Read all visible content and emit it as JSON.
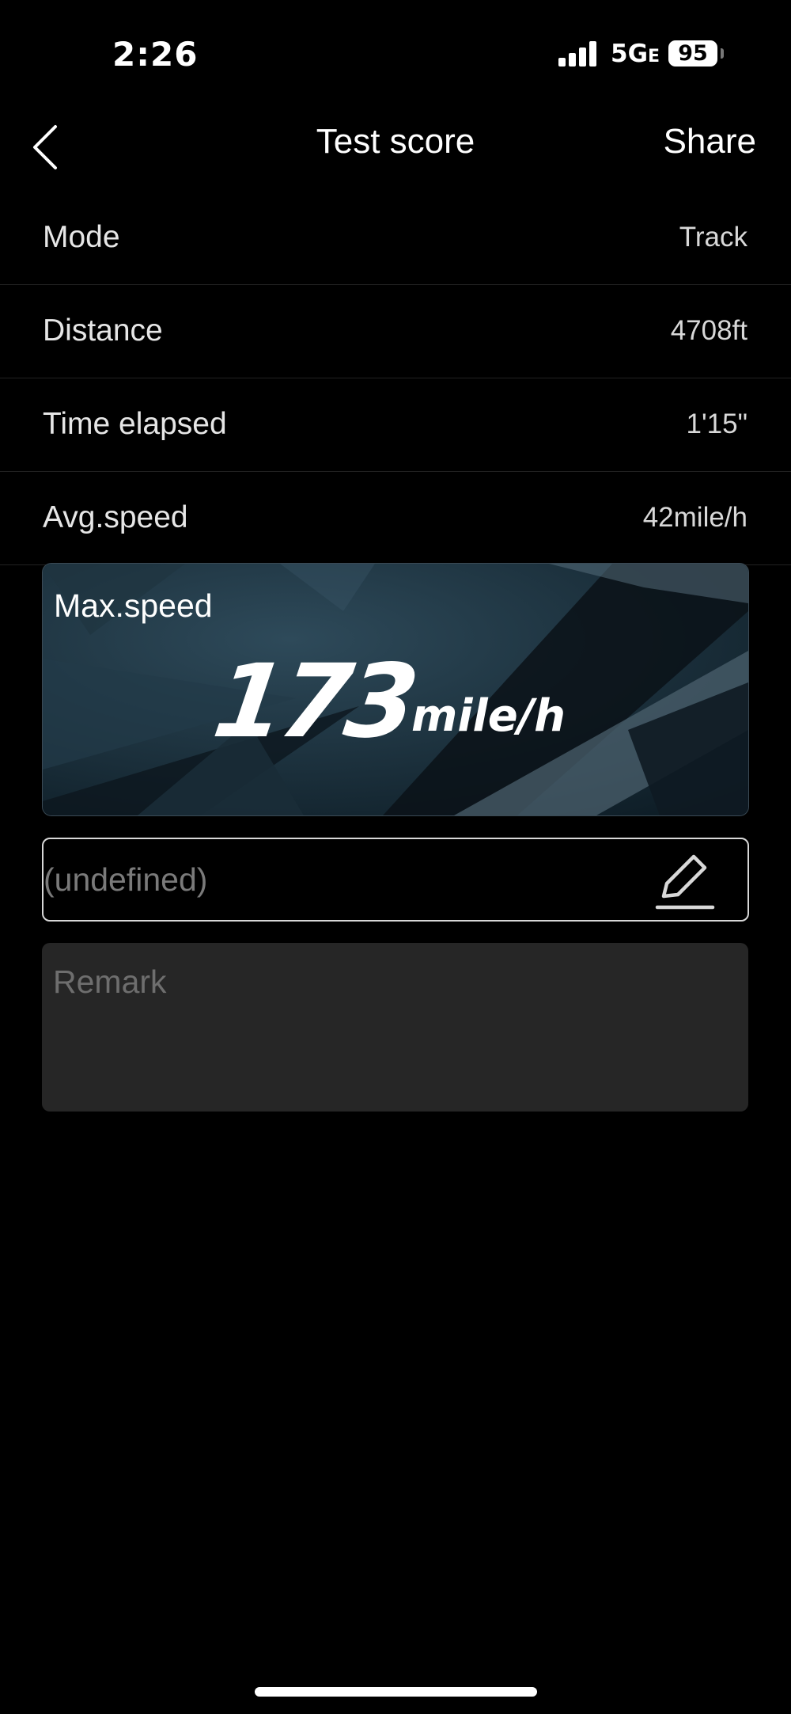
{
  "status_bar": {
    "time": "2:26",
    "network": "5G",
    "network_suffix": "E",
    "battery": "95"
  },
  "nav": {
    "title": "Test score",
    "share_label": "Share"
  },
  "rows": [
    {
      "label": "Mode",
      "value": "Track"
    },
    {
      "label": "Distance",
      "value": "4708ft"
    },
    {
      "label": "Time elapsed",
      "value": "1'15\""
    },
    {
      "label": "Avg.speed",
      "value": "42mile/h"
    }
  ],
  "max_speed": {
    "label": "Max.speed",
    "value": "173",
    "unit": "mile/h"
  },
  "name_field": {
    "value": "(undefined)"
  },
  "remark": {
    "placeholder": "Remark"
  },
  "colors": {
    "background": "#000000",
    "card_bg": "#142a36",
    "remark_bg": "#262626"
  }
}
